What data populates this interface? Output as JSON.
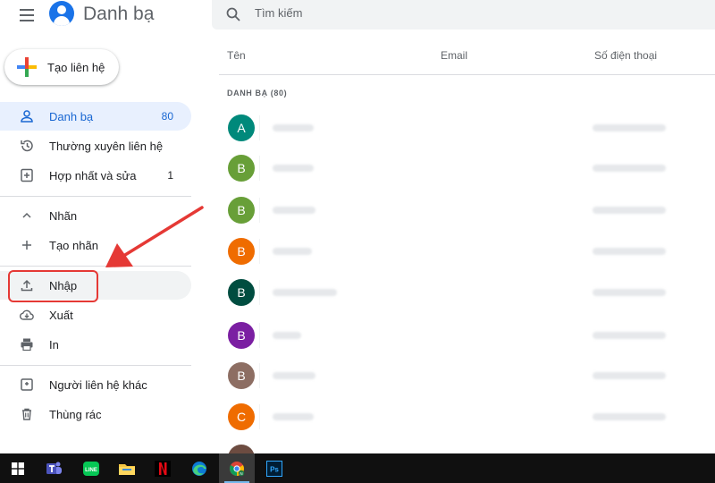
{
  "app": {
    "title": "Danh bạ"
  },
  "sidebar": {
    "create_label": "Tạo liên hệ",
    "items": [
      {
        "label": "Danh bạ",
        "count": "80",
        "icon": "person-icon"
      },
      {
        "label": "Thường xuyên liên hệ",
        "count": "",
        "icon": "history-icon"
      },
      {
        "label": "Hợp nhất và sửa",
        "count": "1",
        "icon": "merge-fix-icon"
      },
      {
        "label": "Nhãn",
        "count": "",
        "icon": "chevron-up-icon"
      },
      {
        "label": "Tạo nhãn",
        "count": "",
        "icon": "plus-icon"
      },
      {
        "label": "Nhập",
        "count": "",
        "icon": "upload-icon"
      },
      {
        "label": "Xuất",
        "count": "",
        "icon": "cloud-download-icon"
      },
      {
        "label": "In",
        "count": "",
        "icon": "printer-icon"
      },
      {
        "label": "Người liên hệ khác",
        "count": "",
        "icon": "contacts-add-icon"
      },
      {
        "label": "Thùng rác",
        "count": "",
        "icon": "trash-icon"
      }
    ]
  },
  "search": {
    "placeholder": "Tìm kiếm"
  },
  "table": {
    "columns": [
      "Tên",
      "Email",
      "Số điện thoại"
    ],
    "section_label": "DANH BẠ (80)",
    "rows": [
      {
        "initial": "A",
        "color": "#00897b"
      },
      {
        "initial": "B",
        "color": "#689f38"
      },
      {
        "initial": "B",
        "color": "#689f38"
      },
      {
        "initial": "B",
        "color": "#ef6c00"
      },
      {
        "initial": "B",
        "color": "#004d40"
      },
      {
        "initial": "B",
        "color": "#7b1fa2"
      },
      {
        "initial": "B",
        "color": "#8d6e63"
      },
      {
        "initial": "C",
        "color": "#ef6c00"
      }
    ]
  },
  "taskbar": {
    "apps": [
      "windows-start-icon",
      "teams-icon",
      "line-icon",
      "file-explorer-icon",
      "netflix-icon",
      "edge-icon",
      "chrome-icon",
      "photoshop-icon"
    ]
  },
  "colors": {
    "accent": "#1a73e8",
    "active_bg": "#e8f0fe",
    "annotation_red": "#e53935"
  }
}
